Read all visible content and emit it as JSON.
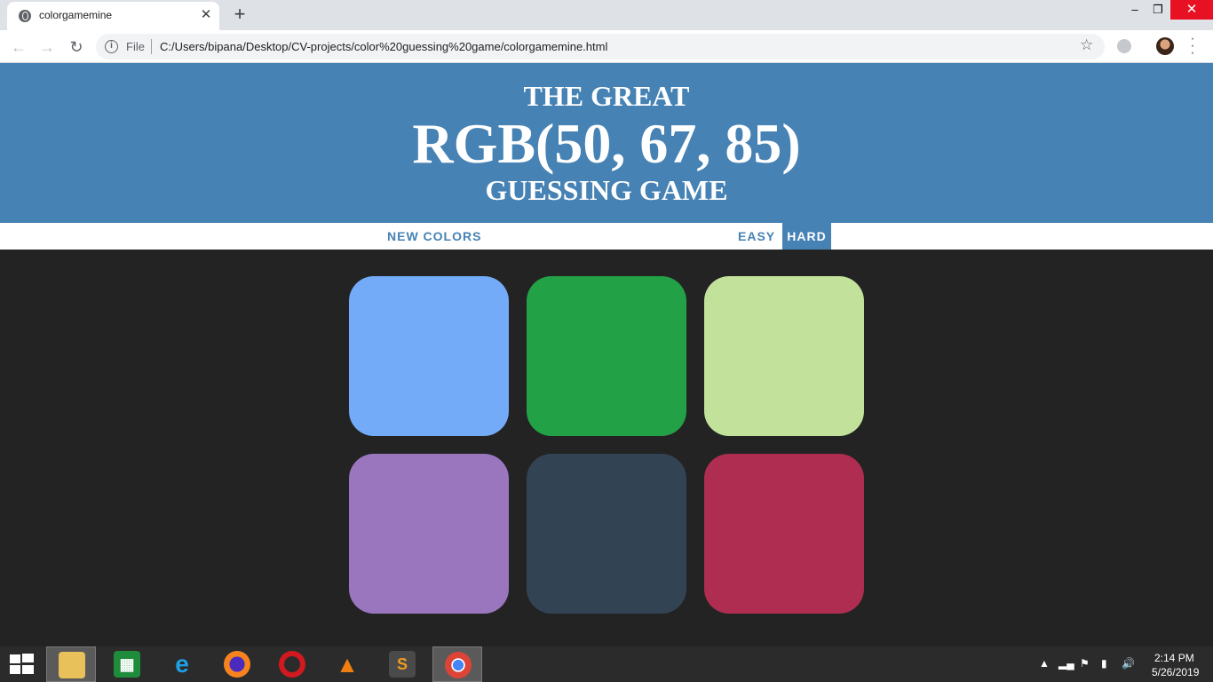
{
  "browser": {
    "tab_title": "colorgamemine",
    "tab_close": "✕",
    "new_tab": "+",
    "scheme": "File",
    "url": "C:/Users/bipana/Desktop/CV-projects/color%20guessing%20game/colorgamemine.html",
    "window_controls": {
      "minimize": "–",
      "maximize": "❐",
      "close": "✕"
    }
  },
  "game": {
    "title_top": "THE GREAT",
    "target_rgb": "RGB(50, 67, 85)",
    "title_bottom": "GUESSING GAME",
    "header_color": "#4682b4",
    "new_colors_label": "NEW COLORS",
    "easy_label": "EASY",
    "hard_label": "HARD",
    "selected_mode": "HARD",
    "squares": [
      "#73abf9",
      "#23a146",
      "#c2e29c",
      "#9a76bf",
      "#324354",
      "#b02d52"
    ]
  },
  "taskbar": {
    "apps": [
      "file-explorer",
      "store",
      "internet-explorer",
      "firefox",
      "opera",
      "vlc",
      "sublime-text",
      "chrome"
    ],
    "active_app": "chrome",
    "time": "2:14 PM",
    "date": "5/26/2019"
  }
}
